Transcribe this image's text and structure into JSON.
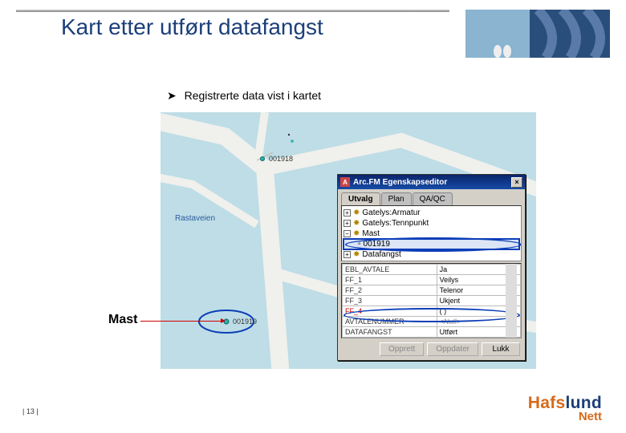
{
  "title": "Kart etter utført datafangst",
  "bullet_arrow": "➤",
  "bullet_text": "Registrerte data vist i kartet",
  "road_label": "Rastaveien",
  "marker1": "001918",
  "marker2": "001919",
  "mast_label": "Mast",
  "dialog": {
    "title": "Arc.FM Egenskapseditor",
    "close": "×",
    "tabs": [
      "Utvalg",
      "Plan",
      "QA/QC"
    ],
    "tree": [
      {
        "exp": "+",
        "label": "Gatelys:Armatur"
      },
      {
        "exp": "+",
        "label": "Gatelys:Tennpunkt"
      },
      {
        "exp": "−",
        "label": "Mast"
      },
      {
        "exp": "",
        "label": "001919",
        "sel": true
      },
      {
        "exp": "+",
        "label": "Datafangst"
      }
    ],
    "props": [
      {
        "name": "EBL_AVTALE",
        "value": "Ja"
      },
      {
        "name": "FF_1",
        "value": "Veilys"
      },
      {
        "name": "FF_2",
        "value": "Telenor"
      },
      {
        "name": "FF_3",
        "value": "Ukjent"
      },
      {
        "name": "FF_4",
        "value": "( )",
        "red": true,
        "circled": true
      },
      {
        "name": "AVTALENUMMER",
        "value": "<Null>",
        "null": true
      },
      {
        "name": "DATAFANGST",
        "value": "Utført"
      }
    ],
    "buttons": {
      "opprett": "Opprett",
      "oppdater": "Oppdater",
      "lukk": "Lukk"
    }
  },
  "footer": {
    "page": "| 13 |",
    "brand1a": "Hafs",
    "brand1b": "lund",
    "brand2": "Nett"
  }
}
